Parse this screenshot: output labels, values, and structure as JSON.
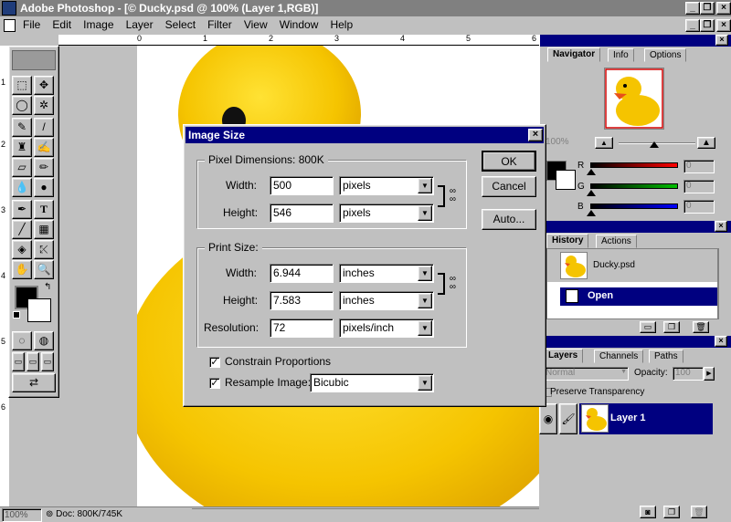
{
  "app": {
    "title": "Adobe Photoshop - [© Ducky.psd @ 100% (Layer 1,RGB)]"
  },
  "menu": [
    "File",
    "Edit",
    "Image",
    "Layer",
    "Select",
    "Filter",
    "View",
    "Window",
    "Help"
  ],
  "menu_underline": [
    "F",
    "E",
    "I",
    "L",
    "S",
    "t",
    "V",
    "W",
    "H"
  ],
  "ruler": {
    "top_ticks": [
      "0",
      "1",
      "2",
      "3",
      "4",
      "5",
      "6"
    ],
    "left_ticks": [
      "1",
      "2",
      "3",
      "4",
      "5",
      "6"
    ]
  },
  "status": {
    "zoom": "100%",
    "doc": "Doc: 800K/745K"
  },
  "dialog": {
    "title": "Image Size",
    "pixel_group_title": "Pixel Dimensions:  800K",
    "width_label": "Width:",
    "height_label": "Height:",
    "pixel_width": "500",
    "pixel_height": "546",
    "pixel_unit_w": "pixels",
    "pixel_unit_h": "pixels",
    "print_group_title": "Print Size:",
    "print_width": "6.944",
    "print_height": "7.583",
    "print_unit_w": "inches",
    "print_unit_h": "inches",
    "resolution_label": "Resolution:",
    "resolution": "72",
    "resolution_unit": "pixels/inch",
    "constrain_label": "Constrain Proportions",
    "constrain_checked": true,
    "resample_label": "Resample Image:",
    "resample_checked": true,
    "resample_method": "Bicubic",
    "ok": "OK",
    "cancel": "Cancel",
    "auto": "Auto..."
  },
  "navigator": {
    "tabs": [
      "Navigator",
      "Info",
      "Options"
    ],
    "zoom": "100%"
  },
  "color": {
    "channels": [
      "R",
      "G",
      "B"
    ],
    "values": [
      "0",
      "0",
      "0"
    ],
    "colors": {
      "r": "#ff0000",
      "g": "#00c000",
      "b": "#0000ff"
    }
  },
  "history": {
    "tabs": [
      "History",
      "Actions"
    ],
    "snapshot": "Ducky.psd",
    "step": "Open"
  },
  "layers": {
    "tabs": [
      "Layers",
      "Channels",
      "Paths"
    ],
    "mode": "Normal",
    "opacity_label": "Opacity:",
    "opacity": "100",
    "preserve": "Preserve Transparency",
    "layer_name": "Layer 1"
  },
  "accent": "#000080"
}
